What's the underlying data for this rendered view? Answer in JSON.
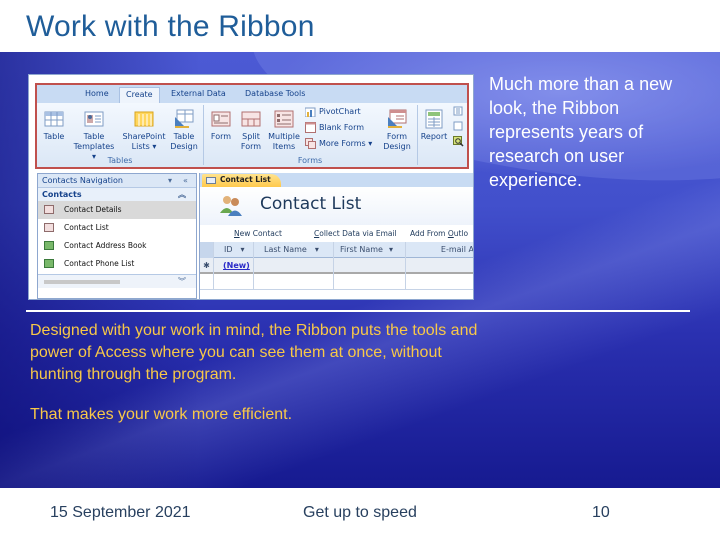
{
  "slide": {
    "title": "Work with the Ribbon",
    "side_text": "Much more than a new look, the Ribbon represents years of research on user experience.",
    "body_paragraphs": [
      "Designed with your work in mind, the Ribbon puts the tools and power of Access where you can see them at once, without hunting through the program.",
      "That makes your work more efficient."
    ],
    "footer": {
      "date": "15 September 2021",
      "title": "Get up to speed",
      "page_number": "10"
    },
    "colors": {
      "title": "#1f5d99",
      "body_text": "#f8c848",
      "side_text": "#ffffff",
      "band": "#3540c0",
      "ribbon_highlight": "#c0504d"
    }
  },
  "access_screenshot": {
    "ribbon": {
      "tabs": [
        {
          "label": "Home",
          "active": false
        },
        {
          "label": "Create",
          "active": true
        },
        {
          "label": "External Data",
          "active": false
        },
        {
          "label": "Database Tools",
          "active": false
        }
      ],
      "groups": [
        {
          "label": "Tables",
          "commands": [
            {
              "label": "Table",
              "icon": "table-icon"
            },
            {
              "label": "Table Templates ▾",
              "icon": "table-templates-icon"
            },
            {
              "label": "SharePoint Lists ▾",
              "icon": "sharepoint-lists-icon"
            },
            {
              "label": "Table Design",
              "icon": "table-design-icon"
            }
          ]
        },
        {
          "label": "Forms",
          "commands": [
            {
              "label": "Form",
              "icon": "form-icon"
            },
            {
              "label": "Split Form",
              "icon": "split-form-icon"
            },
            {
              "label": "Multiple Items",
              "icon": "multiple-items-icon"
            },
            {
              "label": "PivotChart",
              "icon": "pivotchart-icon"
            },
            {
              "label": "Blank Form",
              "icon": "blank-form-icon"
            },
            {
              "label": "More Forms ▾",
              "icon": "more-forms-icon"
            },
            {
              "label": "Form Design",
              "icon": "form-design-icon"
            }
          ]
        },
        {
          "label": "",
          "commands": [
            {
              "label": "Report",
              "icon": "report-icon"
            }
          ]
        }
      ]
    },
    "navigation": {
      "header": "Contacts Navigation",
      "group": "Contacts",
      "items": [
        {
          "label": "Contact Details",
          "type": "form",
          "selected": true
        },
        {
          "label": "Contact List",
          "type": "form",
          "selected": false
        },
        {
          "label": "Contact Address Book",
          "type": "report",
          "selected": false
        },
        {
          "label": "Contact Phone List",
          "type": "report",
          "selected": false
        }
      ]
    },
    "document": {
      "tab_label": "Contact List",
      "form_title": "Contact List",
      "links": {
        "new_contact_u": "N",
        "new_contact_rest": "ew Contact",
        "collect_u": "C",
        "collect_rest": "ollect Data via Email",
        "add_from_pre": "Add From ",
        "add_from_u": "O",
        "add_from_rest": "utlo"
      },
      "columns": [
        "ID",
        "Last Name",
        "First Name",
        "E-mail A"
      ],
      "new_row_marker": "✱",
      "new_row_id": "(New)"
    }
  }
}
